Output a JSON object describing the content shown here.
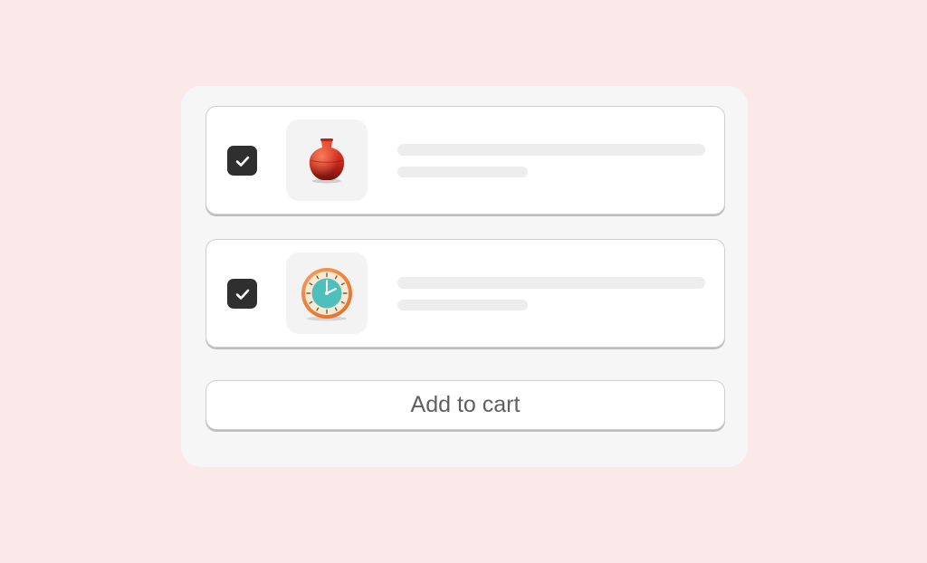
{
  "items": [
    {
      "checked": true,
      "icon": "vase-icon"
    },
    {
      "checked": true,
      "icon": "clock-icon"
    }
  ],
  "cart_button": {
    "label": "Add to cart"
  },
  "colors": {
    "page_background": "#fbe8e8",
    "panel_background": "#f6f6f6",
    "checkbox": "#2f2f2f",
    "skeleton": "#ededed",
    "button_text": "#5f5f5f"
  }
}
